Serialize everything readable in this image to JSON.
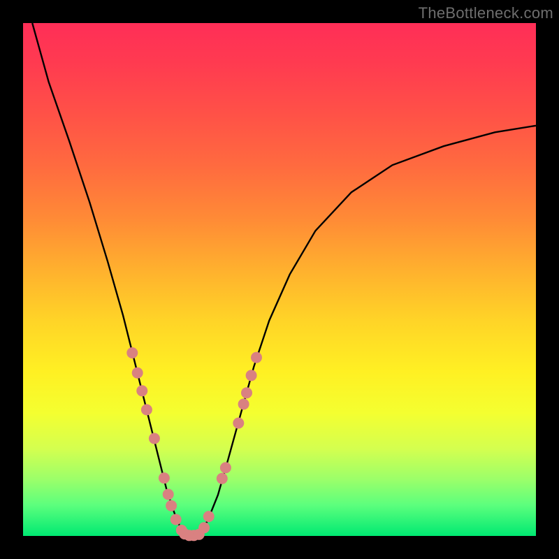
{
  "watermark": "TheBottleneck.com",
  "colors": {
    "frame_bg": "#000000",
    "curve_stroke": "#000000",
    "dot_fill": "#d98181",
    "gradient": [
      "#ff2e57",
      "#ff3b50",
      "#ff5247",
      "#ff6b3f",
      "#ff8a36",
      "#ffb02e",
      "#ffd427",
      "#fff023",
      "#f4ff30",
      "#d4ff4f",
      "#9bff6a",
      "#5cff7d",
      "#00e972"
    ]
  },
  "chart_data": {
    "type": "line",
    "title": "",
    "xlabel": "",
    "ylabel": "",
    "xlim": [
      0,
      1
    ],
    "ylim": [
      0,
      1
    ],
    "series": [
      {
        "name": "curve",
        "x": [
          0.018,
          0.05,
          0.09,
          0.13,
          0.165,
          0.195,
          0.22,
          0.245,
          0.265,
          0.28,
          0.295,
          0.305,
          0.315,
          0.33,
          0.345,
          0.36,
          0.38,
          0.4,
          0.425,
          0.45,
          0.48,
          0.52,
          0.57,
          0.64,
          0.72,
          0.82,
          0.92,
          1.0
        ],
        "y": [
          1.0,
          0.885,
          0.77,
          0.65,
          0.535,
          0.43,
          0.33,
          0.23,
          0.15,
          0.09,
          0.045,
          0.02,
          0.005,
          0.0,
          0.005,
          0.03,
          0.08,
          0.15,
          0.24,
          0.33,
          0.42,
          0.51,
          0.595,
          0.67,
          0.723,
          0.76,
          0.787,
          0.8
        ]
      }
    ],
    "dots_left": [
      {
        "x": 0.213,
        "y": 0.357
      },
      {
        "x": 0.223,
        "y": 0.318
      },
      {
        "x": 0.232,
        "y": 0.283
      },
      {
        "x": 0.241,
        "y": 0.246
      },
      {
        "x": 0.256,
        "y": 0.19
      },
      {
        "x": 0.275,
        "y": 0.113
      },
      {
        "x": 0.283,
        "y": 0.081
      },
      {
        "x": 0.289,
        "y": 0.059
      },
      {
        "x": 0.298,
        "y": 0.032
      },
      {
        "x": 0.309,
        "y": 0.011
      }
    ],
    "dots_bottom": [
      {
        "x": 0.315,
        "y": 0.004
      },
      {
        "x": 0.324,
        "y": 0.001
      },
      {
        "x": 0.333,
        "y": 0.001
      },
      {
        "x": 0.343,
        "y": 0.003
      }
    ],
    "dots_right": [
      {
        "x": 0.353,
        "y": 0.016
      },
      {
        "x": 0.362,
        "y": 0.038
      },
      {
        "x": 0.388,
        "y": 0.112
      },
      {
        "x": 0.395,
        "y": 0.133
      },
      {
        "x": 0.42,
        "y": 0.22
      },
      {
        "x": 0.43,
        "y": 0.257
      },
      {
        "x": 0.436,
        "y": 0.279
      },
      {
        "x": 0.445,
        "y": 0.313
      },
      {
        "x": 0.455,
        "y": 0.348
      }
    ]
  }
}
